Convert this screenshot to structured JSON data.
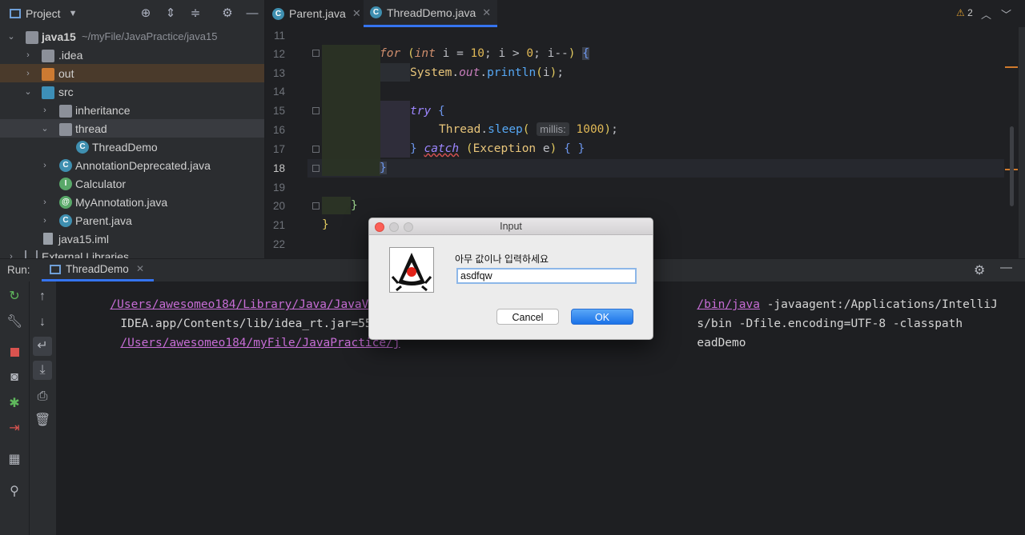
{
  "project": {
    "title": "Project",
    "tree": [
      {
        "label": "java15",
        "path": "~/myFile/JavaPractice/java15",
        "kind": "module"
      },
      {
        "label": ".idea",
        "kind": "folder-grey"
      },
      {
        "label": "out",
        "kind": "folder-orange"
      },
      {
        "label": "src",
        "kind": "folder-blue"
      },
      {
        "label": "inheritance",
        "kind": "package"
      },
      {
        "label": "thread",
        "kind": "package"
      },
      {
        "label": "ThreadDemo",
        "kind": "class"
      },
      {
        "label": "AnnotationDeprecated.java",
        "kind": "class"
      },
      {
        "label": "Calculator",
        "kind": "interface"
      },
      {
        "label": "MyAnnotation.java",
        "kind": "annotation"
      },
      {
        "label": "Parent.java",
        "kind": "class"
      },
      {
        "label": "java15.iml",
        "kind": "file"
      },
      {
        "label": "External Libraries",
        "kind": "library"
      }
    ]
  },
  "editor": {
    "tabs": [
      {
        "label": "Parent.java"
      },
      {
        "label": "ThreadDemo.java",
        "active": true
      }
    ],
    "line_numbers": [
      "11",
      "12",
      "13",
      "14",
      "15",
      "16",
      "17",
      "18",
      "19",
      "20",
      "21",
      "22"
    ],
    "warnings_count": "2",
    "param_hint": "millis:"
  },
  "run": {
    "label": "Run:",
    "tab": "ThreadDemo",
    "console": {
      "l1_link": "/Users/awesomeo184/Library/Java/JavaVirtu",
      "l1_link2": "/bin/java",
      "l1_rest": " -javaagent:/Applications/IntelliJ",
      "l2_a": "IDEA.app/Contents/lib/idea_rt.jar=55112:",
      "l2_b": "s/bin -Dfile.encoding=UTF-8 -classpath",
      "l3_link": "/Users/awesomeo184/myFile/JavaPractice/j",
      "l3_rest": "eadDemo"
    }
  },
  "dialog": {
    "title": "Input",
    "prompt": "아무 값이나 입력하세요",
    "input_value": "asdfqw",
    "cancel_label": "Cancel",
    "ok_label": "OK"
  },
  "colors": {
    "accent": "#3574f0",
    "link": "#c76dd6",
    "ok_button": "#1a72e8"
  }
}
